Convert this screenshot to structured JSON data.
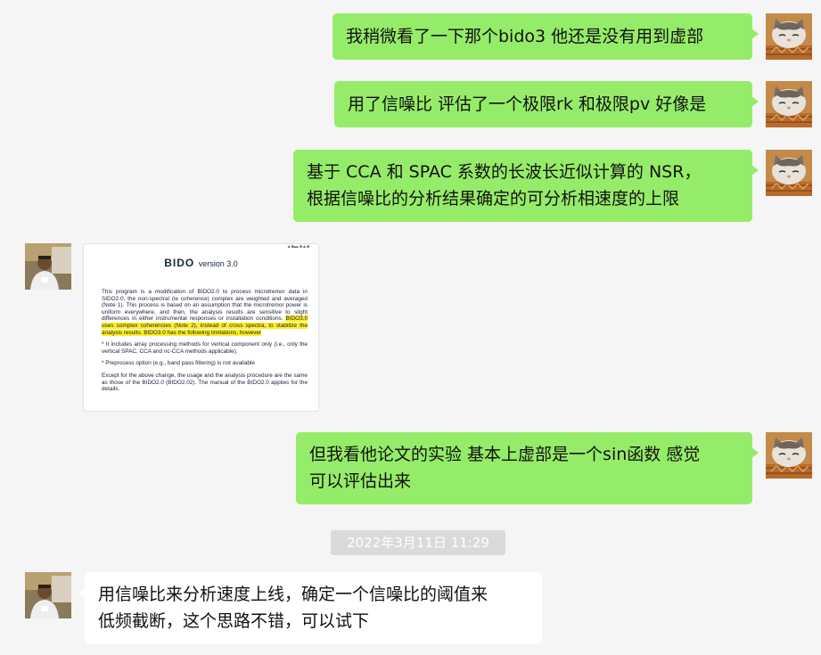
{
  "messages": [
    {
      "sender": "me",
      "lines": [
        "我稍微看了一下那个bido3 他还是没有用到虚部"
      ]
    },
    {
      "sender": "me",
      "lines": [
        "用了信噪比 评估了一个极限rk 和极限pv 好像是"
      ]
    },
    {
      "sender": "me",
      "lines": [
        "基于 CCA 和 SPAC 系数的长波长近似计算的 NSR，",
        "根据信噪比的分析结果确定的可分析相速度的上限"
      ]
    },
    {
      "sender": "other",
      "type": "image",
      "doc": {
        "title": "BIDO",
        "version": "version 3.0",
        "paragraph1": "This program is a modification of BIDO2.0 to process microtremor data in SIDO2.0, the non-spectral (ie coherence) complex are weighted and averaged (Note 1). This process is based on an assumption that the microtremor power is uniform everywhere, and then, the analysis results are sensitive to slight differences in either instrumental responses or installation conditions.",
        "highlight": "BIDO3.0 uses complex coherencies (Note 2), instead of cross spectra, to stabilize the analysis results. BIDO3.0 has the following limitations, however",
        "paragraph2": "* It includes array processing methods for vertical component only (i.e., only the vertical SPAC, CCA and nc-CCA methods applicable).",
        "paragraph3": "* Preprocess option (e.g., band pass filtering) is not available",
        "paragraph4": "Except for the above change, the usage and the analysis procedure are the same as those of the BIDO2.0 (BIDO2.02). The manual of the BIDO2.0 applies for the details."
      }
    },
    {
      "sender": "me",
      "lines": [
        "但我看他论文的实验 基本上虚部是一个sin函数 感觉",
        "可以评估出来"
      ]
    },
    {
      "sender": "other",
      "lines": [
        "用信噪比来分析速度上线，确定一个信噪比的阈值来",
        "低频截断，这个思路不错，可以试下"
      ]
    }
  ],
  "timestamp": "2022年3月11日 11:29",
  "colors": {
    "my_bubble": "#95ec69",
    "other_bubble": "#ffffff",
    "background": "#f5f5f5",
    "timestamp_bg": "#dadada"
  },
  "avatars": {
    "me": "cat-avatar",
    "other": "person-avatar"
  }
}
